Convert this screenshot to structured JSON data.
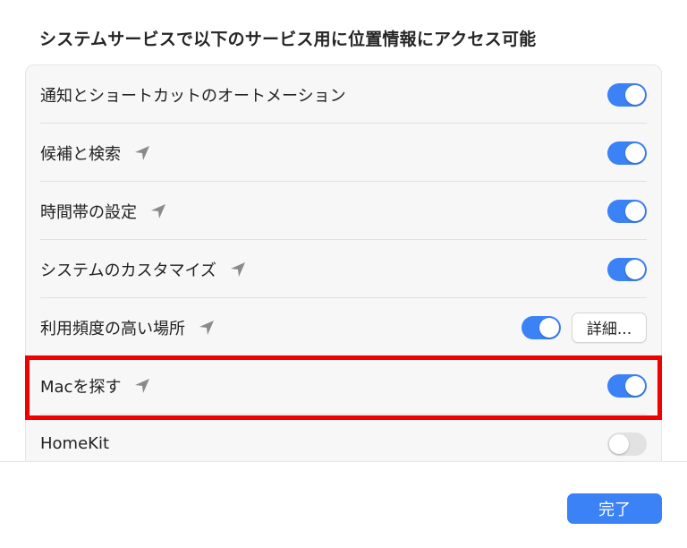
{
  "section": {
    "title": "システムサービスで以下のサービス用に位置情報にアクセス可能"
  },
  "colors": {
    "accent": "#3b82f6",
    "highlight": "#f20000",
    "toggle_off": "#e2e2e2",
    "location_icon": "#8a8a8a"
  },
  "rows": [
    {
      "label": "通知とショートカットのオートメーション",
      "location_icon": false,
      "toggle_on": true
    },
    {
      "label": "候補と検索",
      "location_icon": true,
      "toggle_on": true
    },
    {
      "label": "時間帯の設定",
      "location_icon": true,
      "toggle_on": true
    },
    {
      "label": "システムのカスタマイズ",
      "location_icon": true,
      "toggle_on": true
    },
    {
      "label": "利用頻度の高い場所",
      "location_icon": true,
      "toggle_on": true,
      "button_label": "詳細..."
    },
    {
      "label": "Macを探す",
      "location_icon": true,
      "toggle_on": true
    },
    {
      "label": "HomeKit",
      "location_icon": false,
      "toggle_on": false
    }
  ],
  "footer": {
    "done_label": "完了"
  }
}
